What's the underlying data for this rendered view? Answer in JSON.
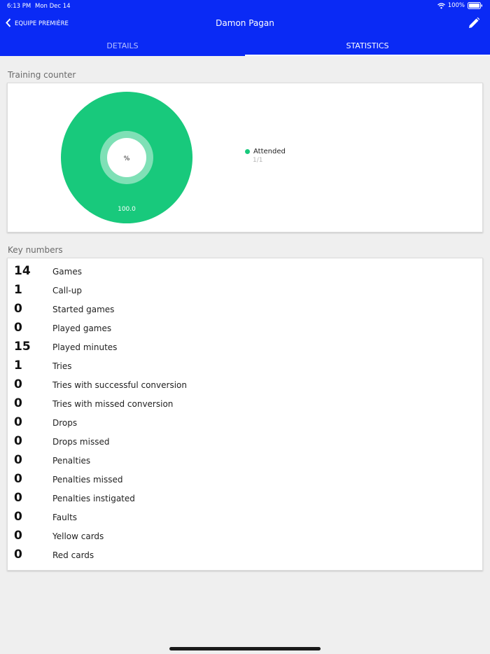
{
  "status_bar": {
    "time": "6:13 PM",
    "date": "Mon Dec 14",
    "battery": "100%"
  },
  "nav": {
    "back_label": "EQUIPE PREMIÈRE",
    "title": "Damon Pagan"
  },
  "tabs": [
    {
      "label": "DETAILS",
      "active": false
    },
    {
      "label": "STATISTICS",
      "active": true
    }
  ],
  "training_counter": {
    "title": "Training counter",
    "center_label": "%",
    "legend": {
      "label": "Attended",
      "value": "1/1",
      "color": "#18c97c"
    }
  },
  "chart_data": {
    "type": "pie",
    "slices": [
      {
        "name": "Attended",
        "value": 100.0,
        "label": "100.0",
        "color": "#18c97c"
      }
    ],
    "center_label": "%"
  },
  "key_numbers": {
    "title": "Key numbers",
    "rows": [
      {
        "value": "14",
        "label": "Games"
      },
      {
        "value": "1",
        "label": "Call-up"
      },
      {
        "value": "0",
        "label": "Started games"
      },
      {
        "value": "0",
        "label": "Played games"
      },
      {
        "value": "15",
        "label": "Played minutes"
      },
      {
        "value": "1",
        "label": "Tries"
      },
      {
        "value": "0",
        "label": "Tries with successful conversion"
      },
      {
        "value": "0",
        "label": "Tries with missed conversion"
      },
      {
        "value": "0",
        "label": "Drops"
      },
      {
        "value": "0",
        "label": "Drops missed"
      },
      {
        "value": "0",
        "label": "Penalties"
      },
      {
        "value": "0",
        "label": "Penalties missed"
      },
      {
        "value": "0",
        "label": "Penalties instigated"
      },
      {
        "value": "0",
        "label": "Faults"
      },
      {
        "value": "0",
        "label": "Yellow cards"
      },
      {
        "value": "0",
        "label": "Red cards"
      }
    ]
  },
  "colors": {
    "header": "#0a2af5",
    "accent": "#18c97c",
    "background": "#efefef"
  }
}
